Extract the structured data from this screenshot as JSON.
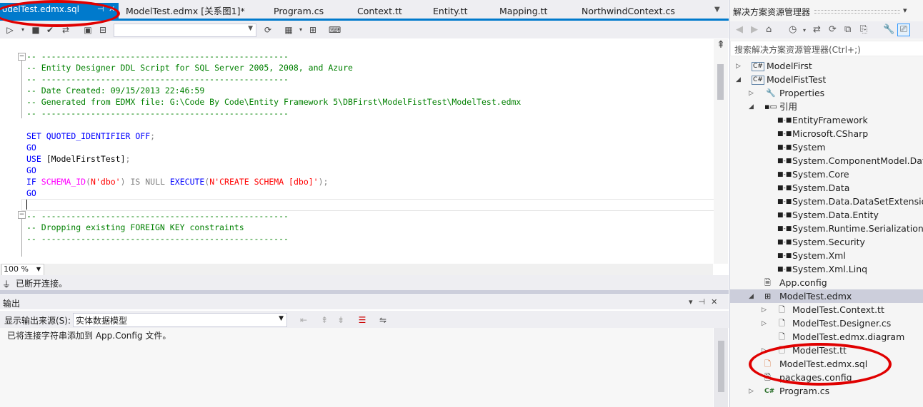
{
  "tabs": [
    {
      "label": "odelTest.edmx.sql",
      "active": true
    },
    {
      "label": "ModelTest.edmx [关系图1]*"
    },
    {
      "label": "Program.cs"
    },
    {
      "label": "Context.tt"
    },
    {
      "label": "Entity.tt"
    },
    {
      "label": "Mapping.tt"
    },
    {
      "label": "NorthwindContext.cs"
    }
  ],
  "editor": {
    "lines": [
      "-- --------------------------------------------------",
      "-- Entity Designer DDL Script for SQL Server 2005, 2008, and Azure",
      "-- --------------------------------------------------",
      "-- Date Created: 09/15/2013 22:46:59",
      "-- Generated from EDMX file: G:\\Code By Code\\Entity Framework 5\\DBFirst\\ModelFistTest\\ModelTest.edmx",
      "-- --------------------------------------------------",
      "-- --------------------------------------------------",
      "-- Dropping existing FOREIGN KEY constraints",
      "-- --------------------------------------------------"
    ],
    "sql": {
      "set": "SET",
      "quoted": "QUOTED_IDENTIFIER",
      "off": "OFF",
      "semi": ";",
      "go": "GO",
      "use": "USE",
      "db": "[ModelFirstTest]",
      "if": "IF",
      "schema_fn": "SCHEMA_ID",
      "lp": "(",
      "rp": ")",
      "arg1": "N'dbo'",
      "isnull": "IS NULL",
      "execute": "EXECUTE",
      "arg2": "N'CREATE SCHEMA [dbo]'"
    },
    "zoom": "100 %"
  },
  "status": {
    "text": "已断开连接。"
  },
  "output": {
    "title": "输出",
    "source_label": "显示输出来源(S):",
    "source_value": "实体数据模型",
    "message": "已将连接字符串添加到 App.Config 文件。"
  },
  "solution_explorer": {
    "title": "解决方案资源管理器",
    "search_placeholder": "搜索解决方案资源管理器(Ctrl+;)",
    "nodes": [
      {
        "label": "ModelFirst",
        "icon": "csharp-project-icon"
      },
      {
        "label": "ModelFistTest",
        "icon": "csharp-project-icon"
      },
      {
        "label": "Properties",
        "icon": "wrench-icon"
      },
      {
        "label": "引用",
        "icon": "references-icon"
      },
      {
        "label": "EntityFramework",
        "icon": "assembly-icon"
      },
      {
        "label": "Microsoft.CSharp",
        "icon": "assembly-icon"
      },
      {
        "label": "System",
        "icon": "assembly-icon"
      },
      {
        "label": "System.ComponentModel.DataA",
        "icon": "assembly-icon"
      },
      {
        "label": "System.Core",
        "icon": "assembly-icon"
      },
      {
        "label": "System.Data",
        "icon": "assembly-icon"
      },
      {
        "label": "System.Data.DataSetExtensions",
        "icon": "assembly-icon"
      },
      {
        "label": "System.Data.Entity",
        "icon": "assembly-icon"
      },
      {
        "label": "System.Runtime.Serialization",
        "icon": "assembly-icon"
      },
      {
        "label": "System.Security",
        "icon": "assembly-icon"
      },
      {
        "label": "System.Xml",
        "icon": "assembly-icon"
      },
      {
        "label": "System.Xml.Linq",
        "icon": "assembly-icon"
      },
      {
        "label": "App.config",
        "icon": "config-file-icon"
      },
      {
        "label": "ModelTest.edmx",
        "icon": "edmx-icon"
      },
      {
        "label": "ModelTest.Context.tt",
        "icon": "template-file-icon"
      },
      {
        "label": "ModelTest.Designer.cs",
        "icon": "template-file-icon"
      },
      {
        "label": "ModelTest.edmx.diagram",
        "icon": "template-file-icon"
      },
      {
        "label": "ModelTest.tt",
        "icon": "template-file-icon"
      },
      {
        "label": "ModelTest.edmx.sql",
        "icon": "sql-file-icon"
      },
      {
        "label": "packages.config",
        "icon": "config-file-icon"
      },
      {
        "label": "Program.cs",
        "icon": "csharp-file-icon"
      }
    ]
  },
  "colors": {
    "accent": "#007acc",
    "annotation": "#e00000"
  }
}
